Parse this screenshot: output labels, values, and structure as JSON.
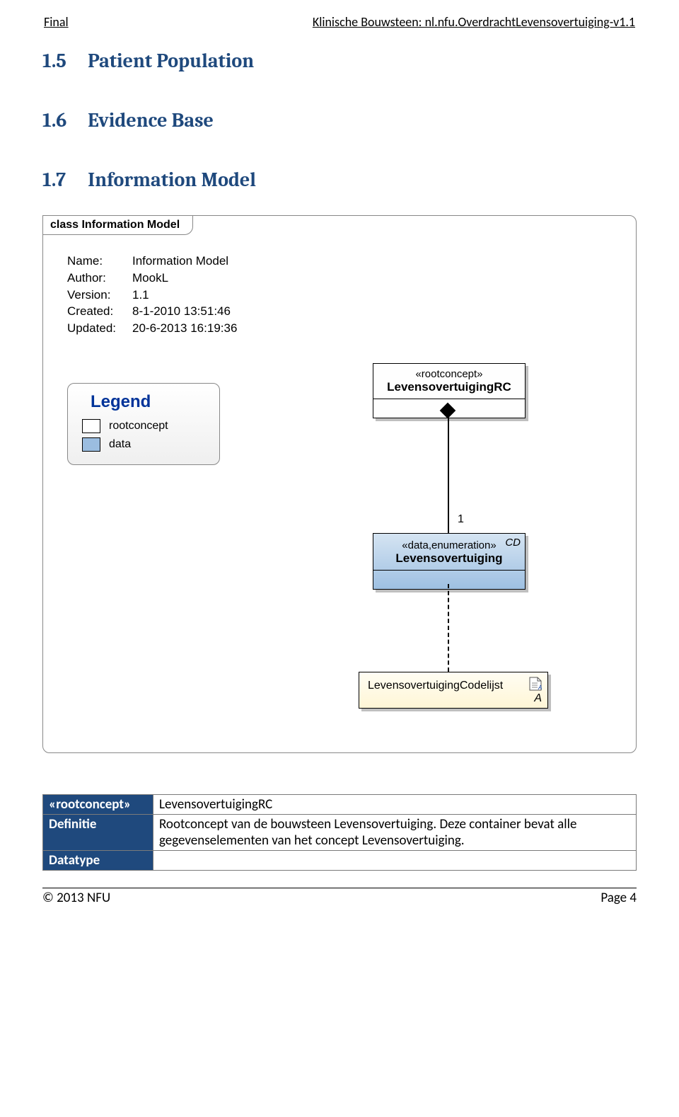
{
  "header": {
    "left": "Final",
    "right": "Klinische Bouwsteen: nl.nfu.OverdrachtLevensovertuiging-v1.1"
  },
  "sections": {
    "s15": {
      "num": "1.5",
      "title": "Patient Population"
    },
    "s16": {
      "num": "1.6",
      "title": "Evidence Base"
    },
    "s17": {
      "num": "1.7",
      "title": "Information Model"
    }
  },
  "diagram": {
    "tab": "class Information Model",
    "meta": {
      "name_k": "Name:",
      "name_v": "Information Model",
      "author_k": "Author:",
      "author_v": "MookL",
      "version_k": "Version:",
      "version_v": "1.1",
      "created_k": "Created:",
      "created_v": "8-1-2010 13:51:46",
      "updated_k": "Updated:",
      "updated_v": "20-6-2013 16:19:36"
    },
    "legend": {
      "title": "Legend",
      "rootconcept": "rootconcept",
      "data": "data"
    },
    "root_class": {
      "stereo": "«rootconcept»",
      "name": "LevensovertuigingRC"
    },
    "data_class": {
      "corner": "CD",
      "stereo": "«data,enumeration»",
      "name": "Levensovertuiging"
    },
    "multiplicity": "1",
    "artifact": {
      "name": "LevensovertuigingCodelijst",
      "a": "A"
    }
  },
  "infobox": {
    "row1_k": "«rootconcept»",
    "row1_v": "LevensovertuigingRC",
    "row2_k": "Definitie",
    "row2_v": "Rootconcept van de bouwsteen Levensovertuiging. Deze container bevat alle gegevenselementen van het concept Levensovertuiging.",
    "row3_k": "Datatype",
    "row3_v": ""
  },
  "footer": {
    "left": "© 2013   NFU",
    "right": "Page 4"
  },
  "chart_data": {
    "type": "diagram",
    "classes": [
      {
        "name": "LevensovertuigingRC",
        "stereotype": "rootconcept",
        "color": "white"
      },
      {
        "name": "Levensovertuiging",
        "stereotype": "data,enumeration",
        "datatype": "CD",
        "color": "blue"
      },
      {
        "name": "LevensovertuigingCodelijst",
        "kind": "artifact",
        "marker": "A"
      }
    ],
    "relations": [
      {
        "from": "LevensovertuigingRC",
        "to": "Levensovertuiging",
        "type": "composition",
        "multiplicity_to": "1"
      },
      {
        "from": "Levensovertuiging",
        "to": "LevensovertuigingCodelijst",
        "type": "dependency"
      }
    ],
    "legend": [
      {
        "label": "rootconcept",
        "color": "#ffffff"
      },
      {
        "label": "data",
        "color": "#9bbde0"
      }
    ],
    "meta": {
      "Name": "Information Model",
      "Author": "MookL",
      "Version": "1.1",
      "Created": "8-1-2010 13:51:46",
      "Updated": "20-6-2013 16:19:36"
    }
  }
}
